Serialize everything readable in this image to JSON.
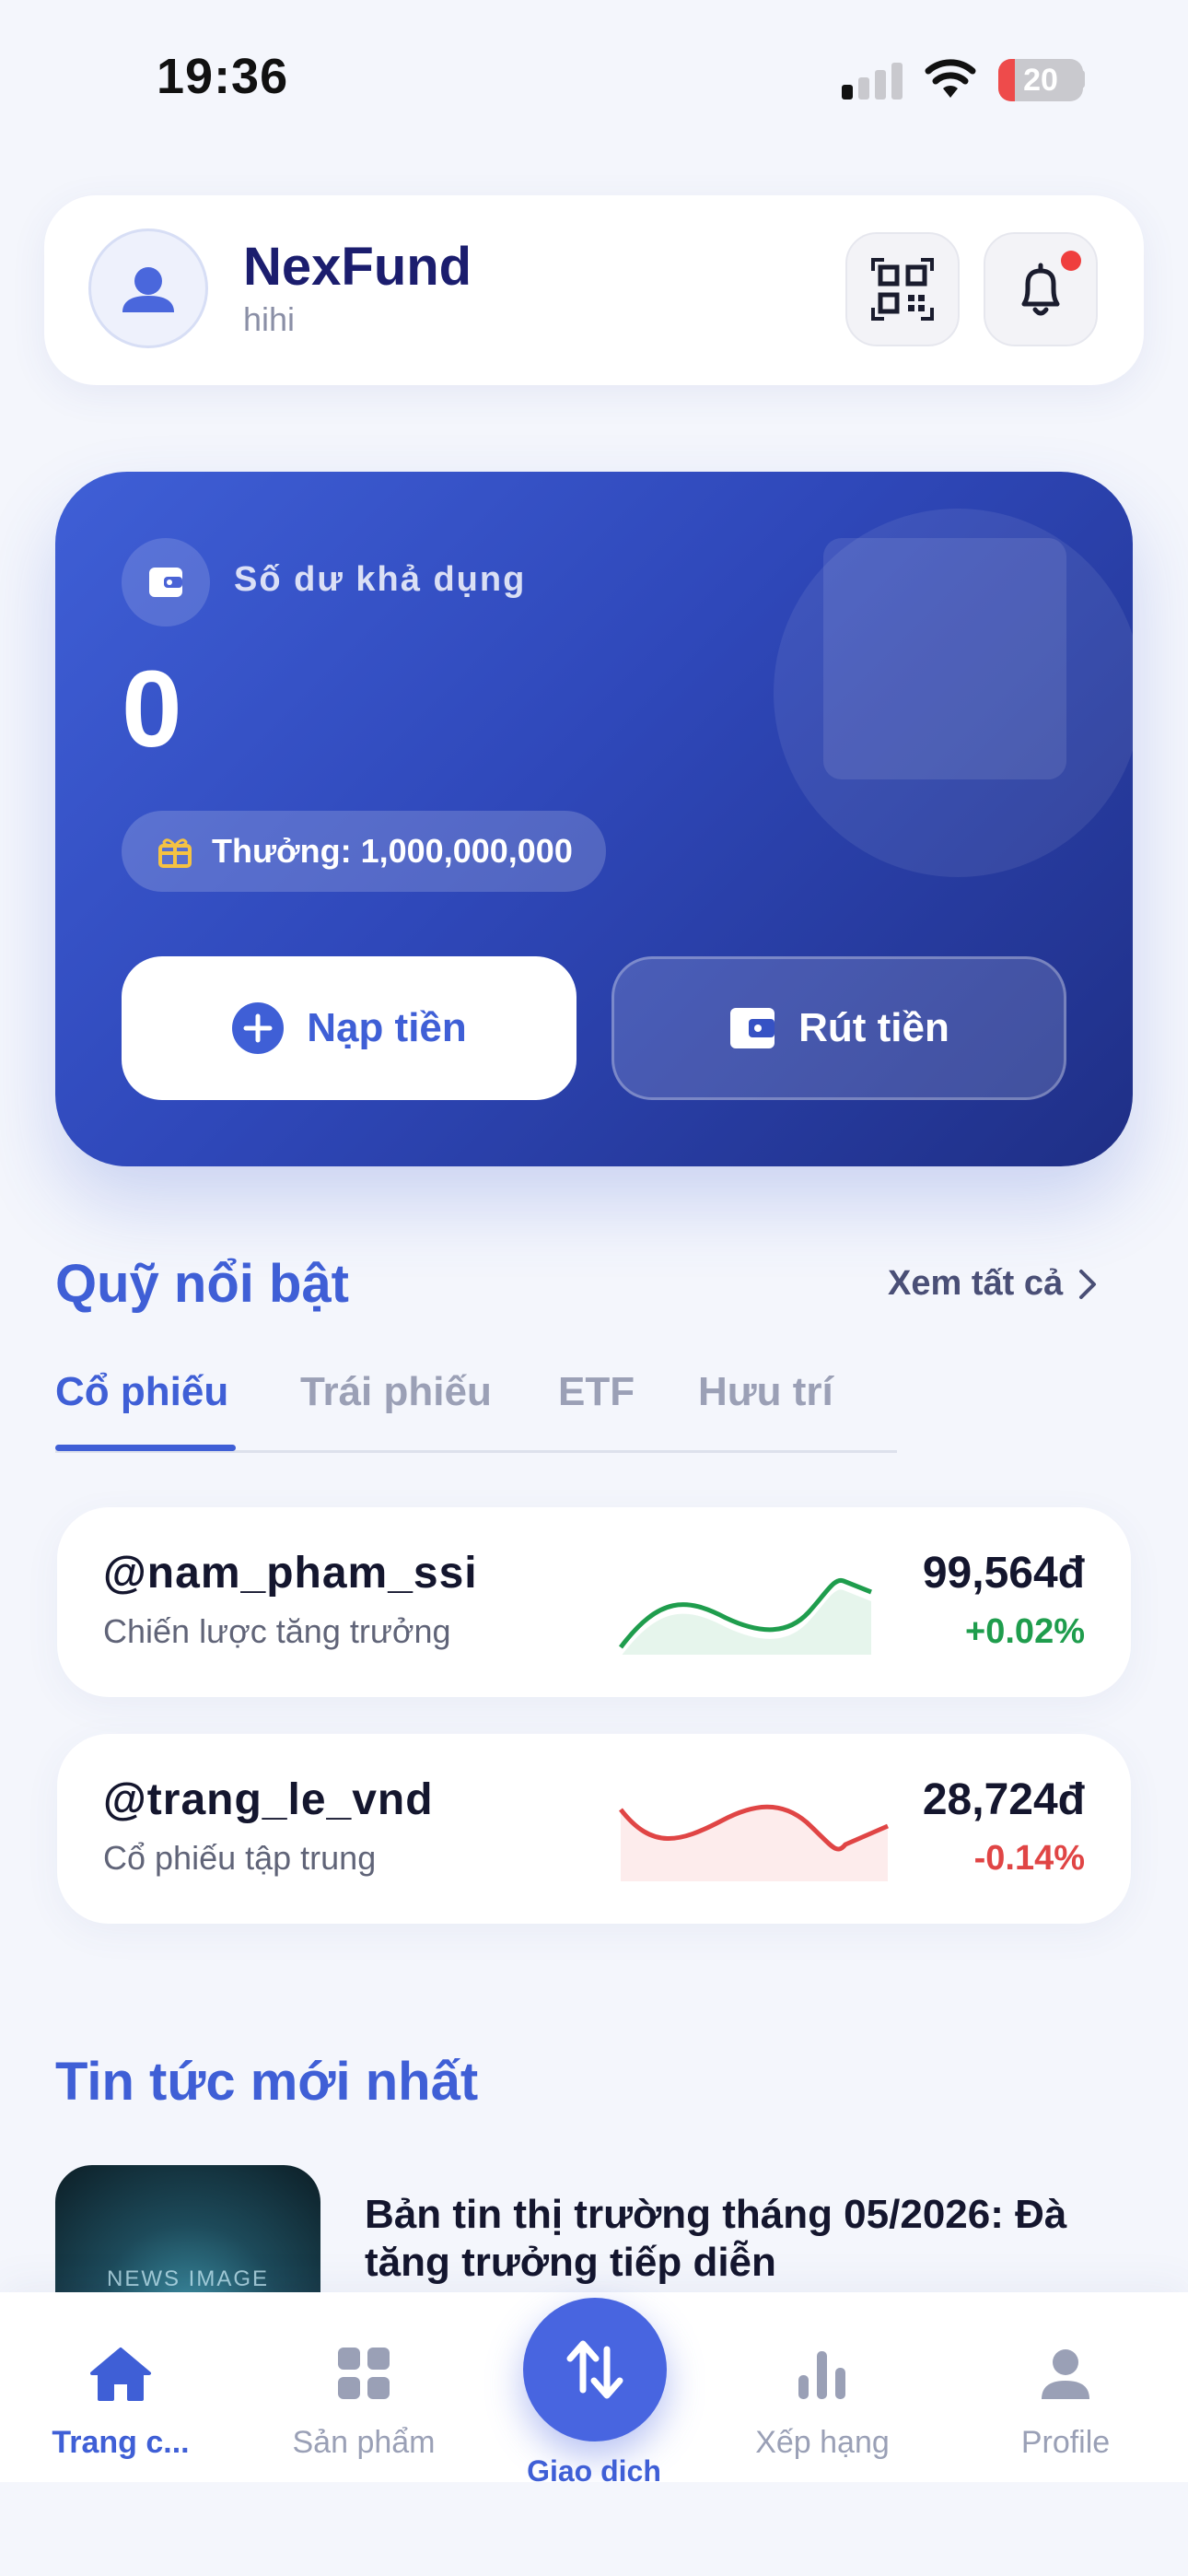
{
  "status_bar": {
    "time": "19:36",
    "battery": "20"
  },
  "header": {
    "app_name": "NexFund",
    "username": "hihi"
  },
  "balance_card": {
    "label": "Số dư khả dụng",
    "value": "0",
    "bonus": "Thưởng: 1,000,000,000",
    "deposit_label": "Nạp tiền",
    "withdraw_label": "Rút tiền"
  },
  "featured": {
    "title": "Quỹ nổi bật",
    "see_all": "Xem tất cả",
    "tabs": [
      {
        "label": "Cổ phiếu",
        "active": true
      },
      {
        "label": "Trái phiếu",
        "active": false
      },
      {
        "label": "ETF",
        "active": false
      },
      {
        "label": "Hưu trí",
        "active": false
      }
    ],
    "funds": [
      {
        "name": "@nam_pham_ssi",
        "desc": "Chiến lược tăng trưởng",
        "price": "99,564đ",
        "change": "+0.02%",
        "trend": "up",
        "color": "#1f9d4d"
      },
      {
        "name": "@trang_le_vnd",
        "desc": "Cổ phiếu tập trung",
        "price": "28,724đ",
        "change": "-0.14%",
        "trend": "down",
        "color": "#e04545"
      }
    ]
  },
  "news": {
    "title": "Tin tức mới nhất",
    "items": [
      {
        "headline": "Bản tin thị trường tháng 05/2026: Đà tăng trưởng tiếp diễn",
        "thumb_text": "NEWS IMAGE"
      }
    ]
  },
  "bottom_nav": {
    "items": [
      {
        "label": "Trang c...",
        "icon": "home-icon",
        "active": true
      },
      {
        "label": "Sản phẩm",
        "icon": "grid-icon",
        "active": false
      },
      {
        "label": "Giao dịch",
        "icon": "transfer-icon",
        "active": false
      },
      {
        "label": "Xếp hạng",
        "icon": "bar-chart-icon",
        "active": false
      },
      {
        "label": "Profile",
        "icon": "user-icon",
        "active": false
      }
    ]
  },
  "colors": {
    "primary": "#3f5fd6",
    "positive": "#1f9d4d",
    "negative": "#e04545"
  }
}
